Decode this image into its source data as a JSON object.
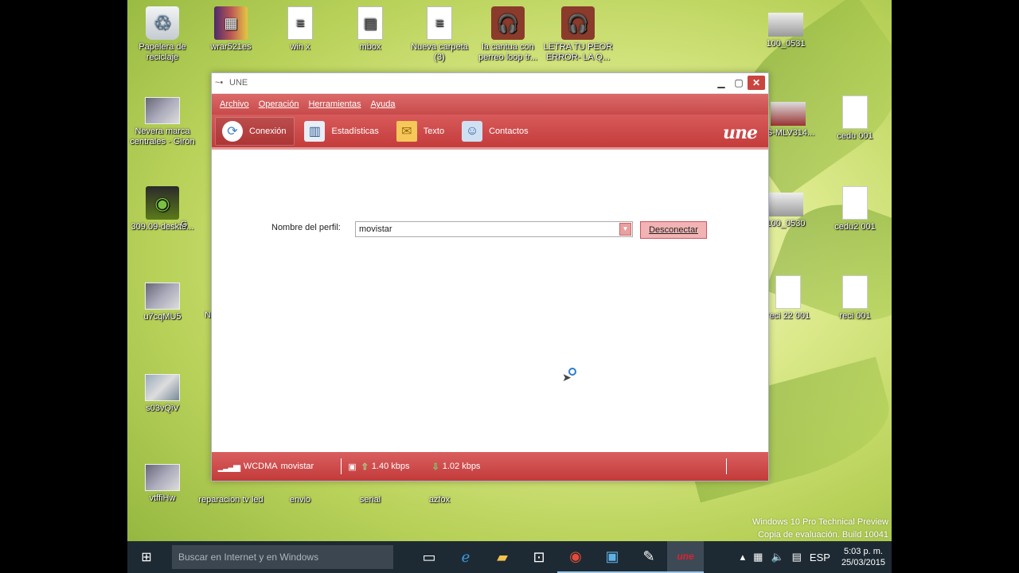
{
  "desktop": {
    "icons": [
      {
        "label": "Papelera de reciclaje",
        "icon": "recycle-bin-icon"
      },
      {
        "label": "wrar521es",
        "icon": "winrar-icon"
      },
      {
        "label": "win x",
        "icon": "document-icon"
      },
      {
        "label": "mbox",
        "icon": "document-icon"
      },
      {
        "label": "Nueva carpeta (3)",
        "icon": "folder-icon"
      },
      {
        "label": "la cantua con perreo loop tr...",
        "icon": "headphones-icon"
      },
      {
        "label": "LETRA TU PEOR ERROR- LA Q...",
        "icon": "headphones-icon"
      },
      {
        "label": "100_0531",
        "icon": "photo-icon"
      },
      {
        "label": "Nevera marca centrales - Girón",
        "icon": "photo-icon"
      },
      {
        "label": "3S-MLV314...",
        "icon": "photo-icon"
      },
      {
        "label": "cedu 001",
        "icon": "document-icon"
      },
      {
        "label": "309.09-deskto...",
        "icon": "nvidia-icon"
      },
      {
        "label": "G",
        "icon": "unknown-icon"
      },
      {
        "label": "100_0530",
        "icon": "photo-icon"
      },
      {
        "label": "cedu2 001",
        "icon": "document-icon"
      },
      {
        "label": "u7cqMU5",
        "icon": "photo-icon"
      },
      {
        "label": "N",
        "icon": "unknown-icon"
      },
      {
        "label": "reci 22 001",
        "icon": "document-icon"
      },
      {
        "label": "reci 001",
        "icon": "document-icon"
      },
      {
        "label": "s03vQiV",
        "icon": "photo-icon"
      },
      {
        "label": "vtffiHw",
        "icon": "photo-icon"
      },
      {
        "label": "reparacion tv led",
        "icon": "document-icon"
      },
      {
        "label": "envio",
        "icon": "document-icon"
      },
      {
        "label": "serial",
        "icon": "document-icon"
      },
      {
        "label": "azfox",
        "icon": "folder-icon"
      }
    ],
    "watermark": {
      "line1": "Windows 10 Pro Technical Preview",
      "line2": "Copia de evaluación. Build 10041"
    }
  },
  "window": {
    "title": "UNE",
    "menu": [
      "Archivo",
      "Operación",
      "Herramientas",
      "Ayuda"
    ],
    "toolbar": [
      {
        "label": "Conexión",
        "icon": "connection-icon",
        "active": true
      },
      {
        "label": "Estadísticas",
        "icon": "statistics-icon",
        "active": false
      },
      {
        "label": "Texto",
        "icon": "envelope-icon",
        "active": false
      },
      {
        "label": "Contactos",
        "icon": "contacts-icon",
        "active": false
      }
    ],
    "brand": "une",
    "form": {
      "profile_label": "Nombre del perfil:",
      "profile_value": "movistar",
      "disconnect_label": "Desconectar"
    },
    "status": {
      "network": "WCDMA",
      "operator": "movistar",
      "upload": "1.40 kbps",
      "download": "1.02 kbps"
    }
  },
  "taskbar": {
    "search_placeholder": "Buscar en Internet y en Windows",
    "language": "ESP",
    "time": "5:03 p. m.",
    "date": "25/03/2015"
  },
  "colors": {
    "accent_red": "#c84a4a",
    "accent_light": "#f1b3b3",
    "taskbar": "#1e2a33"
  }
}
